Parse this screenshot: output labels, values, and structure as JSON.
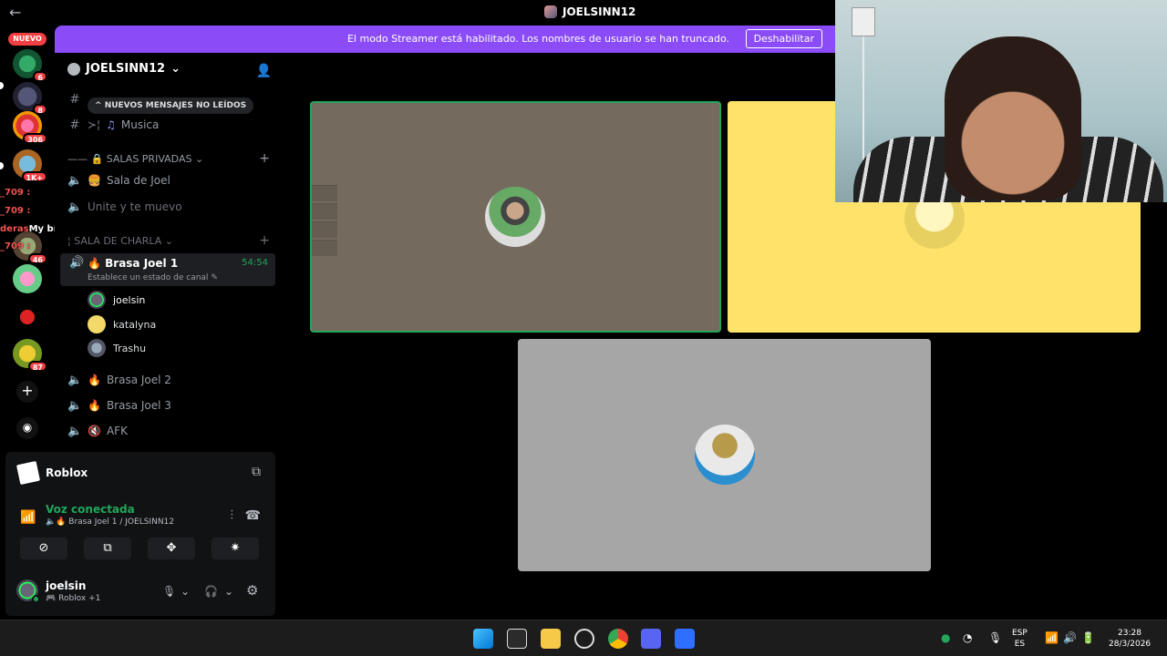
{
  "window": {
    "title": "JOELSINN12"
  },
  "banner": {
    "message": "El modo Streamer está habilitado. Los nombres de usuario se han truncado.",
    "button": "Deshabilitar"
  },
  "rail": {
    "new_pill": "NUEVO",
    "guild_badges": [
      "6",
      "8",
      "306",
      "1K+",
      "46",
      "87"
    ]
  },
  "overlay": {
    "lines": [
      {
        "prefix": "_709 :",
        "text": ""
      },
      {
        "prefix": "_709 :",
        "text": ""
      },
      {
        "prefix": "deras",
        "text": "My broJuega resident requiem"
      },
      {
        "prefix": "_709 :",
        "text": ""
      }
    ]
  },
  "server": {
    "name": "JOELSINN12",
    "unread_pill": "NUEVOS MENSAJES NO LEÍDOS",
    "channels_top": [
      {
        "icon": "#",
        "label": "Musica"
      }
    ],
    "category_private": "SALAS PRIVADAS",
    "private_channels": [
      "Sala de Joel",
      "Unite y te muevo"
    ],
    "category_chat": "SALA DE CHARLA",
    "active_channel": {
      "name": "Brasa Joel 1",
      "status": "Establece un estado de canal",
      "timer": "54:54"
    },
    "voice_users": [
      "joelsin",
      "katalyna",
      "Trashu"
    ],
    "other_channels": [
      "Brasa Joel 2",
      "Brasa Joel 3",
      "AFK"
    ]
  },
  "activity": {
    "game": "Roblox"
  },
  "voice": {
    "title": "Voz conectada",
    "subtitle": "Brasa Joel 1 / JOELSINN12"
  },
  "user": {
    "name": "joelsin",
    "status": "Roblox +1"
  },
  "taskbar": {
    "lang_top": "ESP",
    "lang_bottom": "ES",
    "time": "23:28",
    "date": "28/3/2026"
  }
}
